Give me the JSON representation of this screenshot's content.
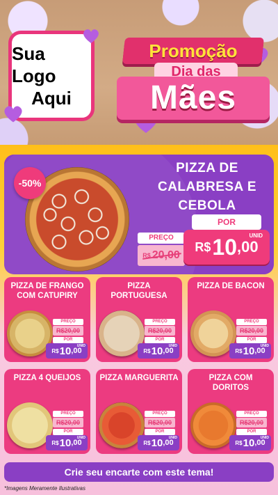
{
  "header": {
    "logo_line1": "Sua Logo",
    "logo_line2": "Aqui",
    "promo_top": "Promoção",
    "promo_mid": "Dia das",
    "promo_bottom": "Mães"
  },
  "featured": {
    "discount": "-50%",
    "name": "PIZZA DE CALABRESA E CEBOLA",
    "preco_label": "PREÇO",
    "old_currency": "R$",
    "old_price": "20,00",
    "por_label": "POR",
    "currency": "R$",
    "price_int": "10",
    "price_dec": ",00",
    "unid": "UNID"
  },
  "cards": [
    {
      "name": "PIZZA DE FRANGO COM CATUPIRY",
      "preco_label": "PREÇO",
      "old_price": "R$20,00",
      "por_label": "POR",
      "currency": "R$",
      "price_int": "10",
      "price_dec": ",00",
      "unid": "UNID"
    },
    {
      "name": "PIZZA PORTUGUESA",
      "preco_label": "PREÇO",
      "old_price": "R$20,00",
      "por_label": "POR",
      "currency": "R$",
      "price_int": "10",
      "price_dec": ",00",
      "unid": "UNID"
    },
    {
      "name": "PIZZA DE BACON",
      "preco_label": "PREÇO",
      "old_price": "R$20,00",
      "por_label": "POR",
      "currency": "R$",
      "price_int": "10",
      "price_dec": ",00",
      "unid": "UNID"
    },
    {
      "name": "PIZZA 4 QUEIJOS",
      "preco_label": "PREÇO",
      "old_price": "R$20,00",
      "por_label": "POR",
      "currency": "R$",
      "price_int": "10",
      "price_dec": ",00",
      "unid": "UNID"
    },
    {
      "name": "PIZZA MARGUERITA",
      "preco_label": "PREÇO",
      "old_price": "R$20,00",
      "por_label": "POR",
      "currency": "R$",
      "price_int": "10",
      "price_dec": ",00",
      "unid": "UNID"
    },
    {
      "name": "PIZZA COM DORITOS",
      "preco_label": "PREÇO",
      "old_price": "R$20,00",
      "por_label": "POR",
      "currency": "R$",
      "price_int": "10",
      "price_dec": ",00",
      "unid": "UNID"
    }
  ],
  "cta": "Crie seu encarte com este tema!",
  "footnote": "*Imagens Meramente Ilustrativas",
  "colors": {
    "pink": "#ec3b80",
    "purple": "#8a3fc4",
    "yellow": "#ffbf1a"
  }
}
